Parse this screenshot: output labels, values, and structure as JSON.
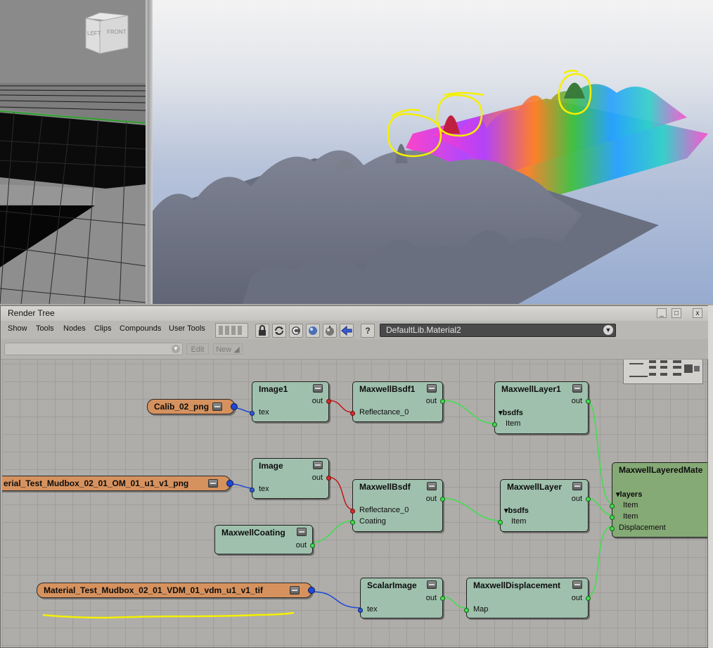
{
  "viewport": {
    "cube_labels": {
      "left": "LEFT",
      "front": "FRONT"
    }
  },
  "panel": {
    "title": "Render Tree",
    "window_buttons": {
      "minimize": "_",
      "maximize": "□",
      "close": "x"
    }
  },
  "menubar": {
    "items": [
      "Show",
      "Tools",
      "Nodes",
      "Clips",
      "Compounds",
      "User Tools"
    ],
    "tool_icons": [
      "memo-slots-icon",
      "lock-icon",
      "refresh-icon",
      "clear-icon",
      "sphere-preview-icon",
      "sphere-icon",
      "back-arrow-icon",
      "help-icon"
    ],
    "help_label": "?",
    "material": "DefaultLib.Material2"
  },
  "toolbar2": {
    "filter_value": "",
    "edit_label": "Edit",
    "new_label": "New ◢"
  },
  "colors": {
    "node_fill": "#9fc0ad",
    "texture_fill": "#d6925e",
    "layered_fill": "#86aa76",
    "link_green": "#3ee04b",
    "link_red": "#c01818",
    "link_blue": "#1f48d6",
    "annotation_yellow": "#f4f000"
  },
  "graph": {
    "textures": {
      "calib": "Calib_02_png",
      "om": "erial_Test_Mudbox_02_01_OM_01_u1_v1_png",
      "vdm": "Material_Test_Mudbox_02_01_VDM_01_vdm_u1_v1_tif"
    },
    "image1": {
      "title": "Image1",
      "out": "out",
      "tex": "tex"
    },
    "bsdf1": {
      "title": "MaxwellBsdf1",
      "out": "out",
      "reflectance": "Reflectance_0"
    },
    "layer1": {
      "title": "MaxwellLayer1",
      "out": "out",
      "bsdfs": "▾bsdfs",
      "item": "Item"
    },
    "image": {
      "title": "Image",
      "out": "out",
      "tex": "tex"
    },
    "bsdf": {
      "title": "MaxwellBsdf",
      "out": "out",
      "reflectance": "Reflectance_0",
      "coating": "Coating"
    },
    "layer": {
      "title": "MaxwellLayer",
      "out": "out",
      "bsdfs": "▾bsdfs",
      "item": "Item"
    },
    "coating": {
      "title": "MaxwellCoating",
      "out": "out"
    },
    "scalar_image": {
      "title": "ScalarImage",
      "out": "out",
      "tex": "tex"
    },
    "displacement": {
      "title": "MaxwellDisplacement",
      "out": "out",
      "map": "Map"
    },
    "layered": {
      "title": "MaxwellLayeredMate",
      "layers": "▾layers",
      "item1": "Item",
      "item2": "Item",
      "displacement": "Displacement"
    }
  }
}
